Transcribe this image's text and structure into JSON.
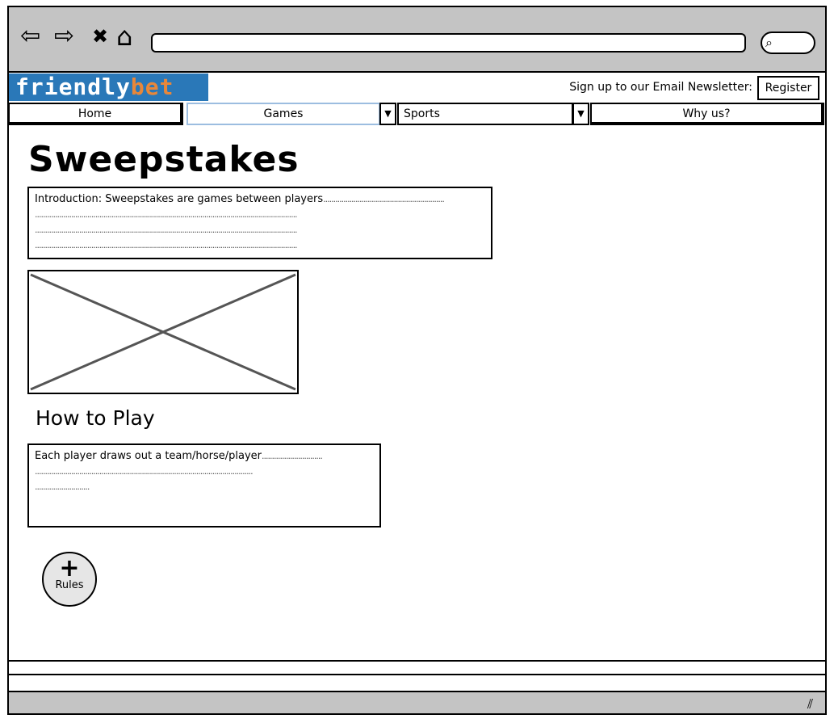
{
  "browser": {
    "back_icon": "back-arrow-icon",
    "forward_icon": "forward-arrow-icon",
    "stop_icon": "close-icon",
    "home_icon": "home-icon",
    "search_icon": "search-icon",
    "glyphs": {
      "back": "⇦",
      "forward": "⇨",
      "stop": "✖",
      "home": "⌂",
      "search": "⌕",
      "resize": "⫽"
    }
  },
  "header": {
    "logo_part1": "friendly",
    "logo_part2": "bet",
    "newsletter_text": "Sign up to our Email Newsletter:",
    "register_label": "Register"
  },
  "nav": {
    "home": "Home",
    "games": "Games",
    "sports": "Sports",
    "why": "Why us?",
    "dropdown_glyph": "▼"
  },
  "main": {
    "title": "Sweepstakes",
    "intro_text": "Introduction: Sweepstakes are games between players",
    "intro_dots_1": "............................................................",
    "intro_dots_2": "..................................................................................................................................",
    "intro_dots_3": "..................................................................................................................................",
    "intro_dots_4": "..................................................................................................................................",
    "how_to_play": "How to Play",
    "play_text": "Each player draws out a team/horse/player",
    "play_dots_1": "..............................",
    "play_dots_2": "............................................................................................................",
    "play_dots_3": "...........................",
    "rules_plus": "+",
    "rules_label": "Rules"
  },
  "colors": {
    "chrome": "#c4c4c4",
    "logo_bg": "#2a78b8",
    "logo_accent": "#e8873a",
    "games_border": "#9cbde0"
  }
}
